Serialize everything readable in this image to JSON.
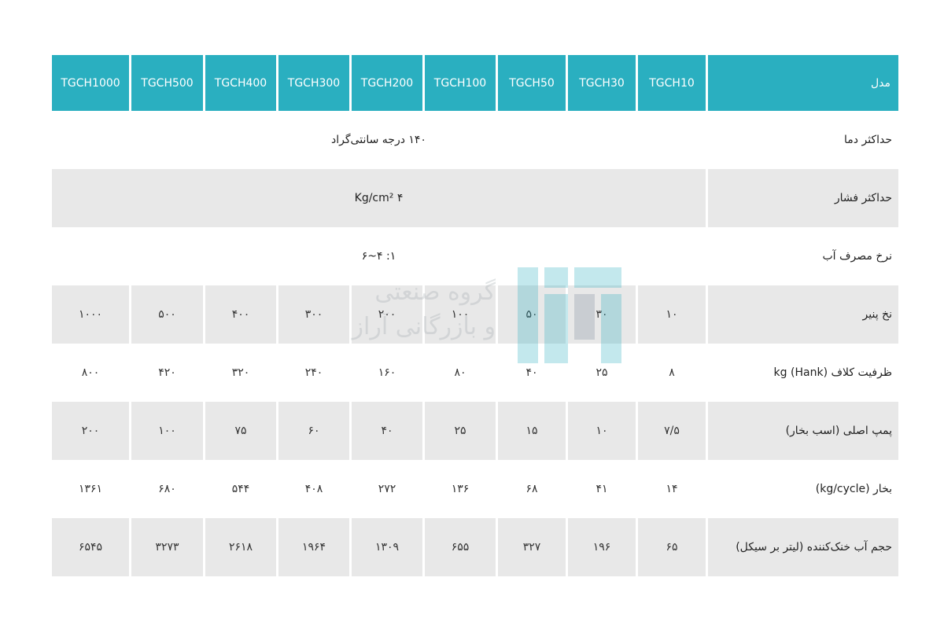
{
  "table": {
    "header_label": "مدل",
    "models": [
      "TGCH10",
      "TGCH30",
      "TGCH50",
      "TGCH100",
      "TGCH200",
      "TGCH300",
      "TGCH400",
      "TGCH500",
      "TGCH1000"
    ],
    "rows": [
      {
        "label": "حداکثر دما",
        "span_value": "۱۴۰ درجه سانتی‌گراد",
        "shaded": false
      },
      {
        "label": "حداکثر فشار",
        "span_value": "۴ Kg/cm²",
        "shaded": true
      },
      {
        "label": "نرخ مصرف آب",
        "span_value": "۱: ۴~۶",
        "shaded": false
      },
      {
        "label": "نخ پنیر",
        "values": [
          "۱۰",
          "۳۰",
          "۵۰",
          "۱۰۰",
          "۲۰۰",
          "۳۰۰",
          "۴۰۰",
          "۵۰۰",
          "۱۰۰۰"
        ],
        "shaded": true
      },
      {
        "label": "ظرفیت کلاف (Hank) kg",
        "values": [
          "۸",
          "۲۵",
          "۴۰",
          "۸۰",
          "۱۶۰",
          "۲۴۰",
          "۳۲۰",
          "۴۲۰",
          "۸۰۰"
        ],
        "shaded": false
      },
      {
        "label": "پمپ اصلی (اسب بخار)",
        "values": [
          "۷/۵",
          "۱۰",
          "۱۵",
          "۲۵",
          "۴۰",
          "۶۰",
          "۷۵",
          "۱۰۰",
          "۲۰۰"
        ],
        "shaded": true
      },
      {
        "label": "بخار (kg/cycle)",
        "values": [
          "۱۴",
          "۴۱",
          "۶۸",
          "۱۳۶",
          "۲۷۲",
          "۴۰۸",
          "۵۴۴",
          "۶۸۰",
          "۱۳۶۱"
        ],
        "shaded": false
      },
      {
        "label": "حجم آب خنک‌کننده (لیتر بر سیکل)",
        "values": [
          "۶۵",
          "۱۹۶",
          "۳۲۷",
          "۶۵۵",
          "۱۳۰۹",
          "۱۹۶۴",
          "۲۶۱۸",
          "۳۲۷۳",
          "۶۵۴۵"
        ],
        "shaded": true
      }
    ]
  },
  "watermark": {
    "line1": "گروه صنعتی",
    "line2": "و بازرگانی آراز",
    "color": "#9aa4a8",
    "logo_color": "#2aafc0"
  },
  "colors": {
    "header_bg": "#2aafc0",
    "shaded_row": "#e8e8e8"
  }
}
